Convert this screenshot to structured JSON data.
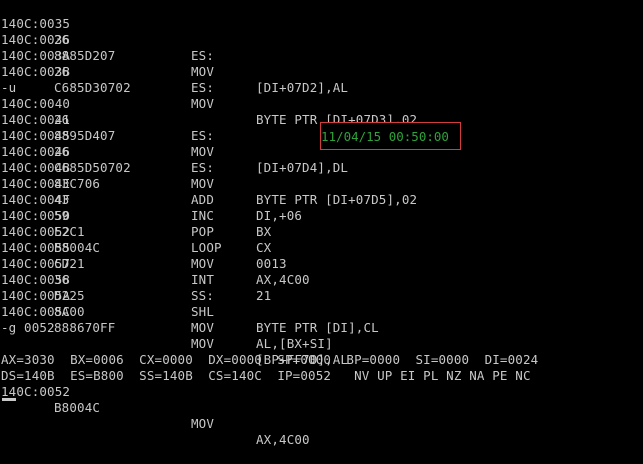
{
  "listing_top": [
    {
      "address": "140C:0035",
      "bytes": "26",
      "mnemonic": "ES:",
      "operands": ""
    },
    {
      "address": "140C:0036",
      "bytes": "8885D207",
      "mnemonic": "MOV",
      "operands": "[DI+07D2],AL"
    },
    {
      "address": "140C:003A",
      "bytes": "26",
      "mnemonic": "ES:",
      "operands": ""
    },
    {
      "address": "140C:003B",
      "bytes": "C685D30702",
      "mnemonic": "MOV",
      "operands": "BYTE PTR [DI+07D3],02"
    }
  ],
  "command_u": "-u",
  "listing_main": [
    {
      "address": "140C:0040",
      "bytes": "26",
      "mnemonic": "ES:",
      "operands": ""
    },
    {
      "address": "140C:0041",
      "bytes": "8895D407",
      "mnemonic": "MOV",
      "operands": "[DI+07D4],DL"
    },
    {
      "address": "140C:0045",
      "bytes": "26",
      "mnemonic": "ES:",
      "operands": ""
    },
    {
      "address": "140C:0046",
      "bytes": "C685D50702",
      "mnemonic": "MOV",
      "operands": "BYTE PTR [DI+07D5],02"
    },
    {
      "address": "140C:004B",
      "bytes": "83C706",
      "mnemonic": "ADD",
      "operands": "DI,+06"
    },
    {
      "address": "140C:004E",
      "bytes": "43",
      "mnemonic": "INC",
      "operands": "BX"
    },
    {
      "address": "140C:004F",
      "bytes": "59",
      "mnemonic": "POP",
      "operands": "CX"
    },
    {
      "address": "140C:0050",
      "bytes": "E2C1",
      "mnemonic": "LOOP",
      "operands": "0013"
    },
    {
      "address": "140C:0052",
      "bytes": "B8004C",
      "mnemonic": "MOV",
      "operands": "AX,4C00"
    },
    {
      "address": "140C:0055",
      "bytes": "CD21",
      "mnemonic": "INT",
      "operands": "21"
    },
    {
      "address": "140C:0057",
      "bytes": "36",
      "mnemonic": "SS:",
      "operands": ""
    },
    {
      "address": "140C:0058",
      "bytes": "D225",
      "mnemonic": "SHL",
      "operands": "BYTE PTR [DI],CL"
    },
    {
      "address": "140C:005A",
      "bytes": "8A00",
      "mnemonic": "MOV",
      "operands": "AL,[BX+SI]"
    },
    {
      "address": "140C:005C",
      "bytes": "888670FF",
      "mnemonic": "MOV",
      "operands": "[BP+FF70],AL"
    }
  ],
  "command_g": "-g 0052",
  "registers_line1": "AX=3030  BX=0006  CX=0000  DX=0000  SP=0000  BP=0000  SI=0000  DI=0024",
  "registers_line2": "DS=140B  ES=B800  SS=140B  CS=140C  IP=0052   NV UP EI PL NZ NA PE NC",
  "current_instruction": {
    "address": "140C:0052",
    "bytes": "B8004C",
    "mnemonic": "MOV",
    "operands": "AX,4C00"
  },
  "clock_overlay": "11/04/15 00:50:00",
  "colors": {
    "background": "#000000",
    "text": "#c8c8c8",
    "clock_text": "#2fa23a",
    "clock_border": "#d23c3c"
  }
}
